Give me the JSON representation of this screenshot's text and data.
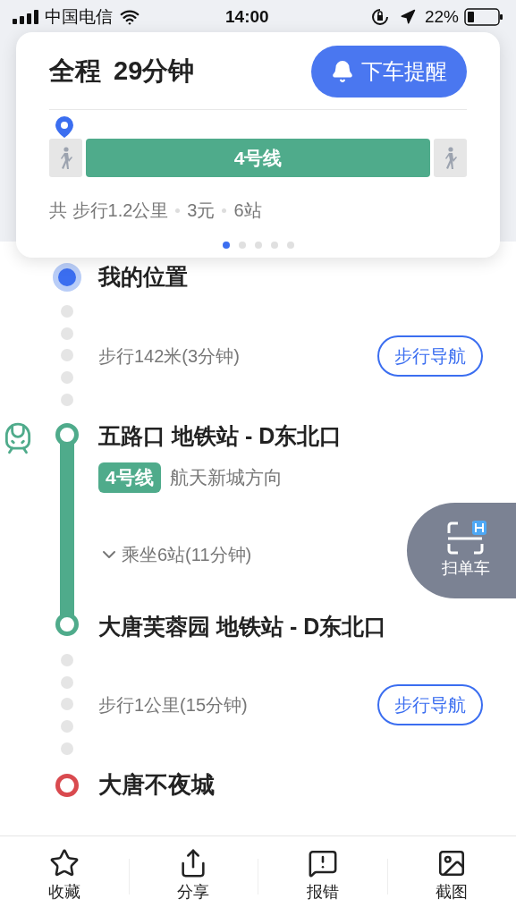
{
  "status_bar": {
    "carrier": "中国电信",
    "time": "14:00",
    "battery": "22%"
  },
  "route": {
    "total_label": "全程",
    "total_time": "29分钟",
    "alert_button": "下车提醒",
    "line_segment": "4号线",
    "summary": [
      "共 步行1.2公里",
      "3元",
      "6站"
    ],
    "pages": [
      {
        "selected": true
      },
      {
        "selected": false
      },
      {
        "selected": false
      },
      {
        "selected": false
      },
      {
        "selected": false
      }
    ]
  },
  "steps": [
    {
      "kind": "start",
      "name": "我的位置"
    },
    {
      "kind": "walk",
      "text": "步行142米(3分钟)",
      "button": "步行导航"
    },
    {
      "kind": "board",
      "name": "五路口 地铁站 - D东北口",
      "line": "4号线",
      "direction": "航天新城方向"
    },
    {
      "kind": "ride",
      "text": "乘坐6站(11分钟)",
      "expanded": false
    },
    {
      "kind": "alight",
      "name": "大唐芙蓉园 地铁站 - D东北口"
    },
    {
      "kind": "walk",
      "text": "步行1公里(15分钟)",
      "button": "步行导航"
    },
    {
      "kind": "end",
      "name": "大唐不夜城"
    }
  ],
  "float_button": "扫单车",
  "tabs": [
    {
      "kind": "star",
      "label": "收藏"
    },
    {
      "kind": "share",
      "label": "分享"
    },
    {
      "kind": "report",
      "label": "报错"
    },
    {
      "kind": "screenshot",
      "label": "截图"
    }
  ]
}
